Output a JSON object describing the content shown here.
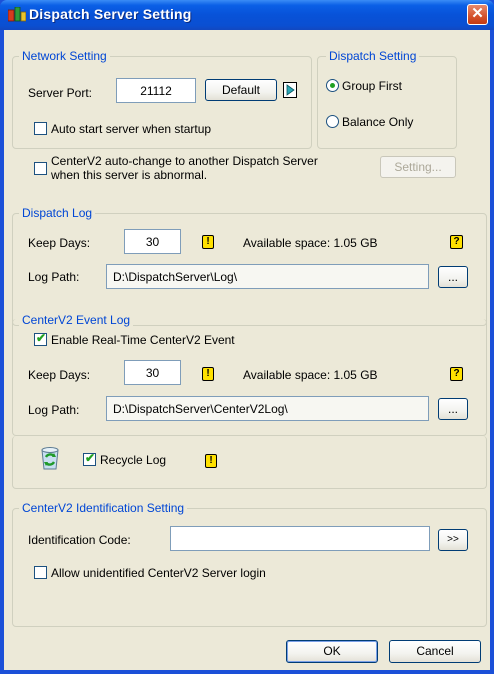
{
  "window": {
    "title": "Dispatch Server Setting",
    "close_glyph": "✕"
  },
  "network": {
    "legend": "Network Setting",
    "server_port_label": "Server Port:",
    "server_port_value": "21112",
    "default_button": "Default",
    "auto_start_label": "Auto start server when startup",
    "auto_start_checked": false,
    "auto_change_label_line1": "CenterV2 auto-change to another Dispatch Server",
    "auto_change_label_line2": "when this server is abnormal.",
    "auto_change_checked": false,
    "setting_button": "Setting..."
  },
  "dispatch": {
    "legend": "Dispatch Setting",
    "group_first_label": "Group First",
    "balance_only_label": "Balance Only",
    "selected": "Group First"
  },
  "dispatch_log": {
    "legend": "Dispatch Log",
    "keep_days_label": "Keep Days:",
    "keep_days_value": "30",
    "available_space": "Available space: 1.05 GB",
    "log_path_label": "Log Path:",
    "log_path_value": "D:\\DispatchServer\\Log\\",
    "browse_button": "..."
  },
  "event_log": {
    "legend": "CenterV2 Event Log",
    "enable_label": "Enable Real-Time CenterV2 Event",
    "enable_checked": true,
    "keep_days_label": "Keep Days:",
    "keep_days_value": "30",
    "available_space": "Available space: 1.05 GB",
    "log_path_label": "Log Path:",
    "log_path_value": "D:\\DispatchServer\\CenterV2Log\\",
    "browse_button": "..."
  },
  "recycle": {
    "label": "Recycle Log",
    "checked": true
  },
  "identification": {
    "legend": "CenterV2 Identification Setting",
    "code_label": "Identification Code:",
    "code_value": "",
    "more_button": ">>",
    "allow_label": "Allow unidentified CenterV2 Server  login",
    "allow_checked": false
  },
  "footer": {
    "ok_button": "OK",
    "cancel_button": "Cancel"
  },
  "icons": {
    "warning_glyph": "!",
    "help_glyph": "?"
  },
  "colors": {
    "titlebar": "#0852d8",
    "dialog_bg": "#ece9d8",
    "legend": "#0046d5",
    "close": "#d4522c",
    "check": "#21a121"
  }
}
